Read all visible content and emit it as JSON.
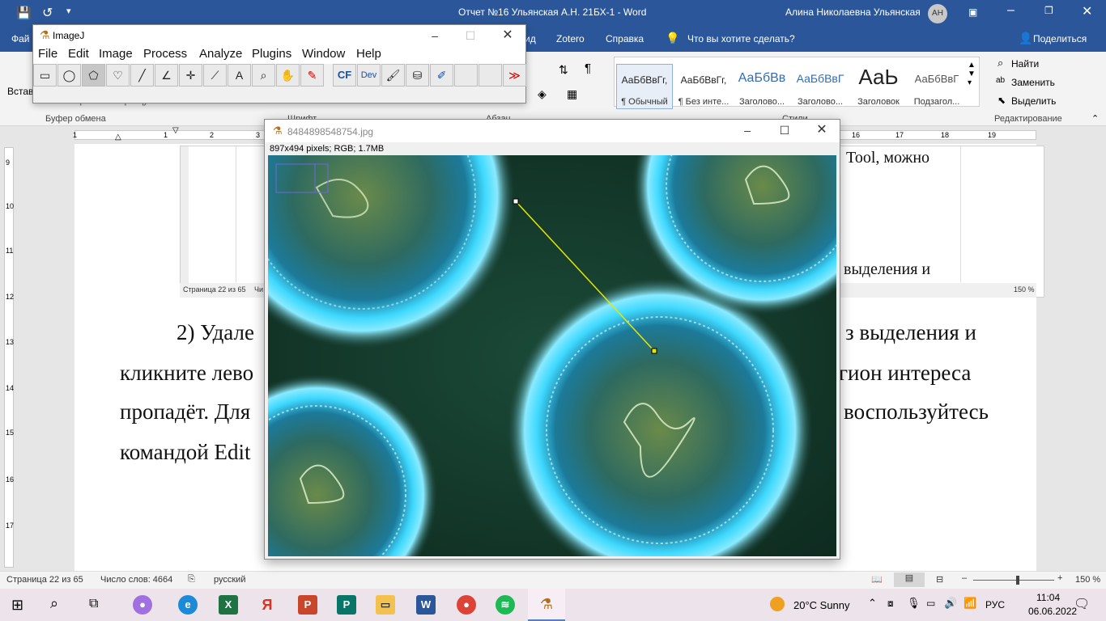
{
  "word": {
    "title": "Отчет №16 Ульянская А.Н. 21БХ-1  -  Word",
    "user": "Алина Николаевна Ульянская",
    "user_initials": "АН",
    "tabs": {
      "file_partial": "Фай",
      "design_partial": "ид",
      "zotero": "Zotero",
      "help": "Справка",
      "tell_me": "Что вы хотите сделать?",
      "share": "Поделиться"
    },
    "ribbon": {
      "paste_partial": "Встав",
      "format_painter": "Формат по образцу",
      "clipboard_label": "Буфер обмена",
      "font_label_partial": "Шрифт",
      "paragraph_label_partial": "Абзац",
      "styles_label_partial": "Стили",
      "editing_label": "Редактирование",
      "find": "Найти",
      "replace": "Заменить",
      "select": "Выделить",
      "styles": [
        {
          "sample": "АаБбВвГг,",
          "name": "¶ Обычный"
        },
        {
          "sample": "АаБбВвГг,",
          "name": "¶ Без инте..."
        },
        {
          "sample": "АаБбВв",
          "name": "Заголово..."
        },
        {
          "sample": "АаБбВвГ",
          "name": "Заголово..."
        },
        {
          "sample": "АаЬ",
          "name": "Заголовок"
        },
        {
          "sample": "АаБбВвГ",
          "name": "Подзагол..."
        }
      ]
    },
    "ruler_numbers": [
      "1",
      "1",
      "2",
      "3",
      "16",
      "17",
      "18",
      "19"
    ],
    "vruler_numbers": [
      "9",
      "10",
      "11",
      "12",
      "13",
      "14",
      "15",
      "16",
      "17"
    ],
    "document": {
      "embedded_right_top": "Tool, можно",
      "embedded_right_bottom": "выделения и",
      "embedded_status": "Страница 22 из 65",
      "embedded_status_word": "Чи",
      "embedded_zoom": "150 %",
      "line1_left": "2) Удале",
      "line1_right": "з выделения и",
      "line2_left": "кликните лево",
      "line2_right": "егион интереса",
      "line3_left": "пропадёт. Для",
      "line3_right": "воспользуйтесь",
      "line4_left": "командой Edit"
    },
    "status": {
      "page": "Страница 22 из 65",
      "words": "Число слов: 4664",
      "language": "русский",
      "zoom": "150 %"
    }
  },
  "imagej": {
    "title": "ImageJ",
    "menu": [
      "File",
      "Edit",
      "Image",
      "Process",
      "Analyze",
      "Plugins",
      "Window",
      "Help"
    ],
    "tools": [
      {
        "name": "rectangle-tool",
        "glyph": "▭"
      },
      {
        "name": "oval-tool",
        "glyph": "◯"
      },
      {
        "name": "polygon-tool",
        "glyph": "⬠"
      },
      {
        "name": "freehand-tool",
        "glyph": "♡"
      },
      {
        "name": "line-tool",
        "glyph": "╱"
      },
      {
        "name": "angle-tool",
        "glyph": "∠"
      },
      {
        "name": "point-tool",
        "glyph": "✛"
      },
      {
        "name": "wand-tool",
        "glyph": "⟋"
      },
      {
        "name": "text-tool",
        "glyph": "A"
      },
      {
        "name": "magnifier-tool",
        "glyph": "⌕"
      },
      {
        "name": "hand-tool",
        "glyph": "✋"
      },
      {
        "name": "color-picker-tool",
        "glyph": "✎"
      },
      {
        "name": "cf-tool",
        "glyph": "CF"
      },
      {
        "name": "dev-tool",
        "glyph": "Dev"
      },
      {
        "name": "brush-tool",
        "glyph": "🖌"
      },
      {
        "name": "flood-fill-tool",
        "glyph": "⛁"
      },
      {
        "name": "pencil-tool",
        "glyph": "✐"
      },
      {
        "name": "empty-slot-1",
        "glyph": ""
      },
      {
        "name": "empty-slot-2",
        "glyph": ""
      },
      {
        "name": "more-tools",
        "glyph": "≫"
      }
    ],
    "image_window": {
      "title": "8484898548754.jpg",
      "info": "897x494 pixels; RGB; 1.7MB"
    }
  },
  "taskbar": {
    "temperature": "20°C  Sunny",
    "language": "РУС",
    "time": "11:04",
    "date": "06.06.2022"
  },
  "colors": {
    "word_blue": "#2b579a",
    "line_roi": "#e6e600",
    "canvas_bg": "#14382a",
    "cell_glow": "#3fd9ff"
  }
}
